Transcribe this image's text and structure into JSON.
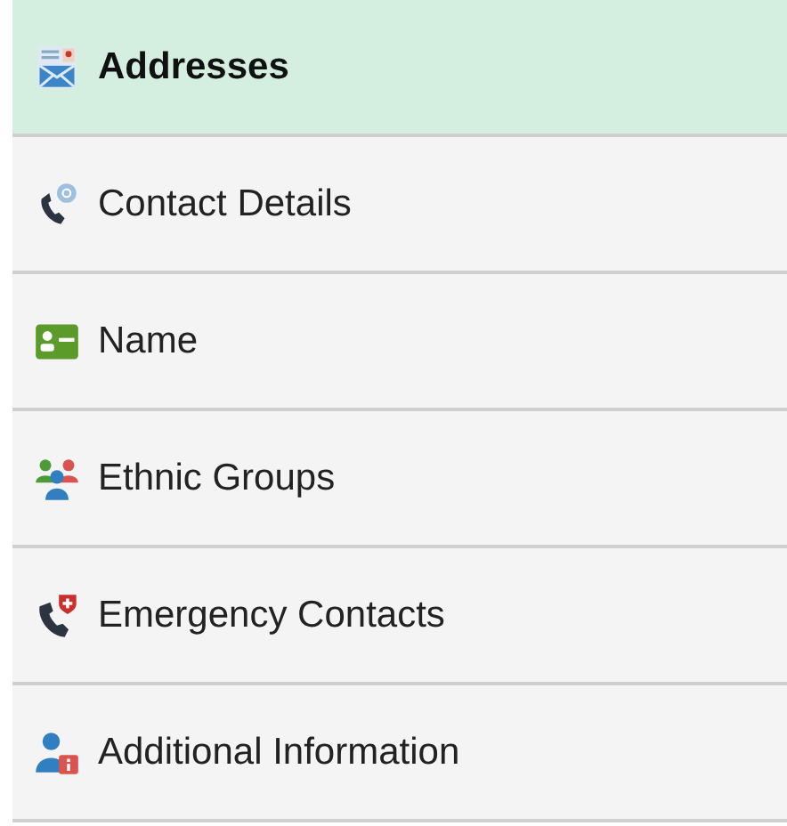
{
  "menu": {
    "items": [
      {
        "label": "Addresses",
        "kind": "address",
        "selected": true
      },
      {
        "label": "Contact Details",
        "kind": "contact",
        "selected": false
      },
      {
        "label": "Name",
        "kind": "name",
        "selected": false
      },
      {
        "label": "Ethnic Groups",
        "kind": "groups",
        "selected": false
      },
      {
        "label": "Emergency Contacts",
        "kind": "emergency",
        "selected": false
      },
      {
        "label": "Additional Information",
        "kind": "info",
        "selected": false
      }
    ]
  }
}
